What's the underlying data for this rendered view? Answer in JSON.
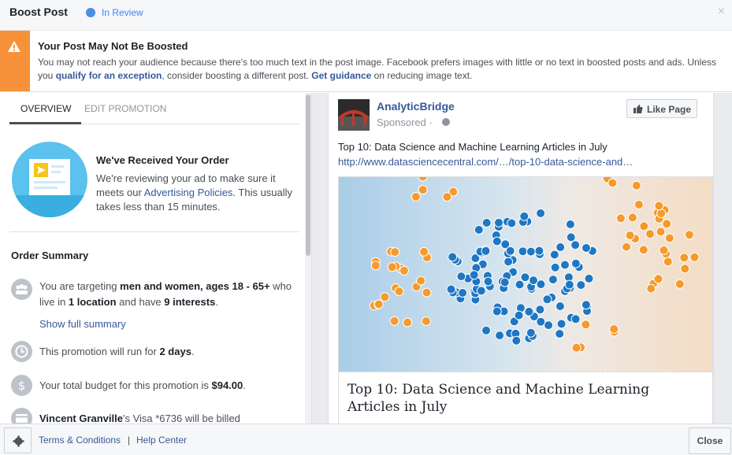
{
  "header": {
    "title": "Boost Post",
    "status": "In Review",
    "close_glyph": "×",
    "status_color": "#4a90e2"
  },
  "warning": {
    "title": "Your Post May Not Be Boosted",
    "body_1": "You may not reach your audience because there's too much text in the post image. Facebook prefers images with little or no text in boosted posts and ads. Unless you ",
    "link_exception": "qualify for an exception",
    "body_2": ", consider boosting a different post. ",
    "link_guidance": "Get guidance",
    "body_3": " on reducing image text.",
    "accent_color": "#f7923a"
  },
  "tabs": [
    {
      "label": "OVERVIEW"
    },
    {
      "label": "EDIT PROMOTION"
    }
  ],
  "order": {
    "title": "We've Received Your Order",
    "body_1": "We're reviewing your ad to make sure it meets our ",
    "link": "Advertising Policies",
    "body_2": ". This usually takes less than 15 minutes."
  },
  "summary": {
    "title": "Order Summary",
    "targeting": {
      "t1": "You are targeting ",
      "b1": "men and women",
      "t2": ", ",
      "b2": "ages 18 - 65+",
      "t3": " who live in ",
      "b3": "1 location",
      "t4": " and have ",
      "b4": "9 interests",
      "t5": "."
    },
    "show_full": "Show full summary",
    "duration": {
      "t1": "This promotion will run for ",
      "b1": "2 days",
      "t2": "."
    },
    "budget": {
      "t1": "Your total budget for this promotion is ",
      "b1": "$94.00",
      "t2": "."
    },
    "billing": {
      "b1": "Vincent Granville",
      "t1": "'s Visa *6736 will be billed"
    }
  },
  "post": {
    "page_name": "AnalyticBridge",
    "sponsored": "Sponsored · ",
    "like_label": "Like Page",
    "text": "Top 10: Data Science and Machine Learning Articles in July",
    "link": "http://www.datasciencecentral.com/…/top-10-data-science-and…",
    "headline": "Top 10: Data Science and Machine Learning Articles in July"
  },
  "footer": {
    "terms": "Terms & Conditions",
    "separator": "|",
    "help": "Help Center",
    "close": "Close"
  },
  "icons": [
    "close-icon",
    "warning-icon",
    "megaphone-illustration",
    "people-icon",
    "clock-icon",
    "dollar-icon",
    "card-icon",
    "globe-icon",
    "thumbs-up-icon",
    "gear-icon"
  ]
}
